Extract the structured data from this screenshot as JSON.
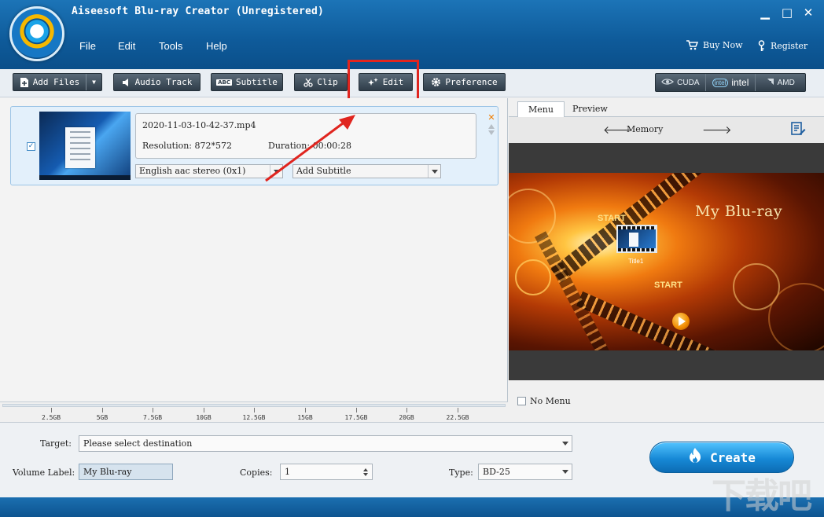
{
  "app": {
    "title": "Aiseesoft Blu-ray Creator (Unregistered)",
    "menu": [
      "File",
      "Edit",
      "Tools",
      "Help"
    ],
    "buy_now": "Buy Now",
    "register": "Register",
    "window_controls": {
      "minimize": "▁",
      "maximize": "□",
      "close": "✕"
    }
  },
  "toolbar": {
    "add_files": "Add Files",
    "audio_track": "Audio Track",
    "subtitle": "Subtitle",
    "subtitle_icon_text": "ABC",
    "clip": "Clip",
    "edit": "Edit",
    "preference": "Preference",
    "gpu": {
      "cuda": "CUDA",
      "intel_badge": "intel",
      "intel": "intel",
      "amd": "AMD"
    }
  },
  "file": {
    "checked": true,
    "name": "2020-11-03-10-42-37.mp4",
    "resolution_label": "Resolution: 872*572",
    "duration_label": "Duration: 00:00:28",
    "audio_track": "English aac stereo (0x1)",
    "subtitle": "Add Subtitle"
  },
  "capacity_ruler": {
    "ticks": [
      "2.5GB",
      "5GB",
      "7.5GB",
      "10GB",
      "12.5GB",
      "15GB",
      "17.5GB",
      "20GB",
      "22.5GB"
    ]
  },
  "preview": {
    "tabs": [
      "Menu",
      "Preview"
    ],
    "active_tab": "Menu",
    "template_name": "Memory",
    "menu_title": "My Blu-ray",
    "start_1": "START",
    "start_2": "START",
    "title_item": "Title1",
    "no_menu_label": "No Menu",
    "no_menu_checked": false
  },
  "output": {
    "target_label": "Target:",
    "target_value": "Please select destination",
    "volume_label": "Volume Label:",
    "volume_value": "My Blu-ray",
    "copies_label": "Copies:",
    "copies_value": "1",
    "type_label": "Type:",
    "type_value": "BD-25",
    "create_label": "Create"
  },
  "watermark": "下载吧",
  "colors": {
    "title_bar": "#0e5a99",
    "highlight": "#e0251f",
    "create_button": "#1789d6"
  }
}
